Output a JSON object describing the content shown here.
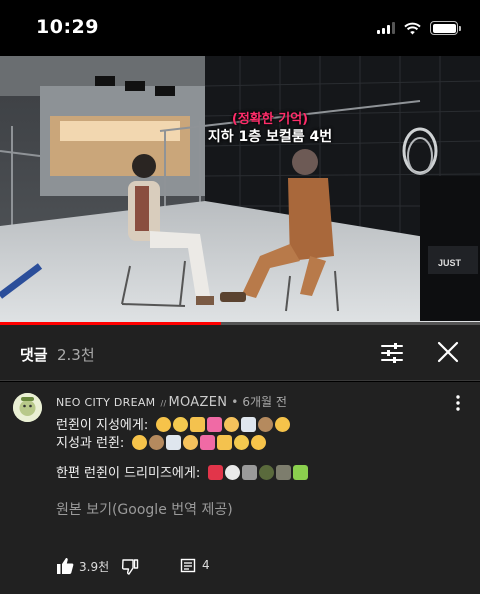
{
  "status_bar": {
    "time": "10:29"
  },
  "video": {
    "caption_line1": "(정확한 기억)",
    "caption_line2": "지하 1층 보컬룸 4번",
    "progress_fraction": 0.46
  },
  "comments_header": {
    "title": "댓글",
    "count": "2.3천"
  },
  "comment": {
    "author": "NEO CITY DREAM",
    "author_handle": "MOAZEN",
    "handle_prefix": "//",
    "separator": "•",
    "time_ago": "6개월 전",
    "line1_text": "런쥔이 지성에게:",
    "line2_text": "지성과 런쥔:",
    "line3_text": "한편 런쥔이 드리미즈에게:",
    "translate_text": "원본 보기(Google 번역 제공)",
    "like_count": "3.9천",
    "reply_count": "4"
  },
  "colors": {
    "accent_red": "#ff0000",
    "caption_pink": "#ff2d6a",
    "panel_bg": "#212121"
  }
}
